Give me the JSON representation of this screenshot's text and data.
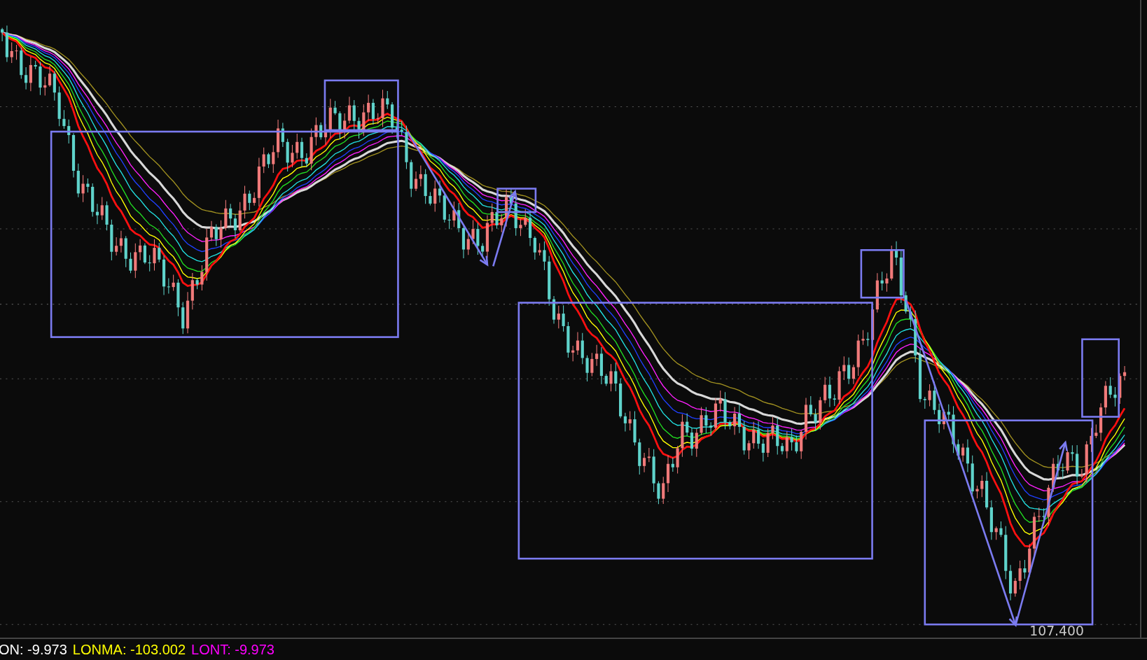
{
  "chart": {
    "price_label": "107.400"
  },
  "legend": [
    {
      "text": "ON: -9.973",
      "color": "#ffffff"
    },
    {
      "text": "LONMA: -103.002",
      "color": "#ffff00"
    },
    {
      "text": "LONT: -9.973",
      "color": "#ff00ff"
    }
  ]
}
